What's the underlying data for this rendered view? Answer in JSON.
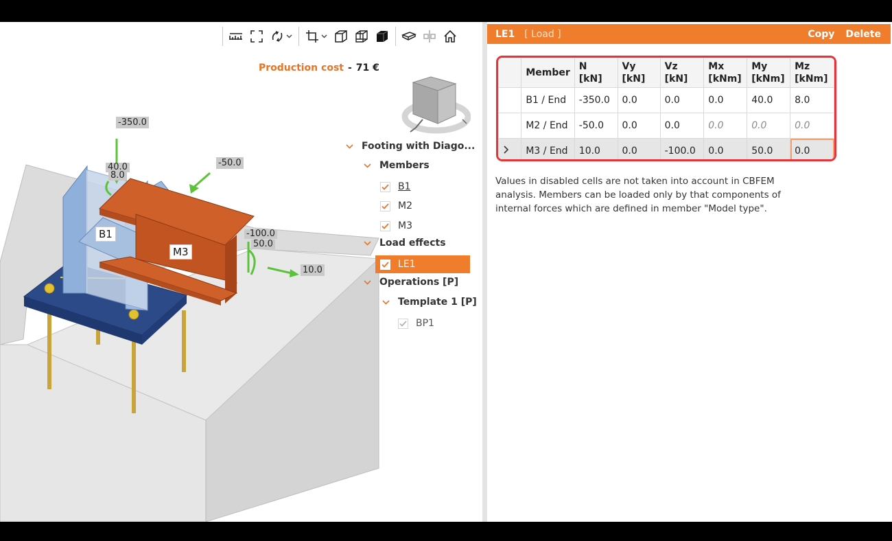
{
  "toolbar": {
    "icons": [
      "ruler-icon",
      "fit-view-icon",
      "rotate-icon",
      "crop-icon",
      "wireframe-cube-icon",
      "transparent-cube-icon",
      "solid-cube-icon",
      "section-icon",
      "mirror-icon",
      "home-icon"
    ]
  },
  "cost": {
    "label": "Production cost",
    "separator": "-",
    "value": "71 €"
  },
  "viewport_labels": {
    "load_b1_n": "-350.0",
    "load_b1_my": "40.0",
    "load_b1_mz": "8.0",
    "load_m2_n": "-50.0",
    "load_m3_vz": "-100.0",
    "load_m3_my": "50.0",
    "load_m3_n": "10.0",
    "member_b1": "B1",
    "member_m3": "M3"
  },
  "tree": {
    "root": "Footing with Diago...",
    "members_header": "Members",
    "members": [
      "B1",
      "M2",
      "M3"
    ],
    "load_effects_header": "Load effects",
    "load_effect_selected": "LE1",
    "operations_header": "Operations [P]",
    "template": "Template 1 [P]",
    "template_item": "BP1"
  },
  "panel": {
    "name": "LE1",
    "type": "[ Load ]",
    "copy_label": "Copy",
    "delete_label": "Delete"
  },
  "table": {
    "headers": [
      {
        "name": "Member",
        "unit": ""
      },
      {
        "name": "N",
        "unit": "[kN]"
      },
      {
        "name": "Vy",
        "unit": "[kN]"
      },
      {
        "name": "Vz",
        "unit": "[kN]"
      },
      {
        "name": "Mx",
        "unit": "[kNm]"
      },
      {
        "name": "My",
        "unit": "[kNm]"
      },
      {
        "name": "Mz",
        "unit": "[kNm]"
      }
    ],
    "rows": [
      {
        "member": "B1 / End",
        "N": "-350.0",
        "Vy": "0.0",
        "Vz": "0.0",
        "Mx": "0.0",
        "My": "40.0",
        "Mz": "8.0"
      },
      {
        "member": "M2 / End",
        "N": "-50.0",
        "Vy": "0.0",
        "Vz": "0.0",
        "Mx": "0.0",
        "My": "0.0",
        "Mz": "0.0"
      },
      {
        "member": "M3 / End",
        "N": "10.0",
        "Vy": "0.0",
        "Vz": "-100.0",
        "Mx": "0.0",
        "My": "50.0",
        "Mz": "0.0"
      }
    ]
  },
  "note": "Values in disabled cells are not taken into account in CBFEM analysis. Members can be loaded only by that components of internal forces which are defined in member \"Model type\".",
  "colors": {
    "accent": "#ef7d2c",
    "highlight": "#e4343a",
    "steel_orange": "#d0602a",
    "steel_blue": "#8fb0da",
    "plate": "#2b4a86"
  }
}
